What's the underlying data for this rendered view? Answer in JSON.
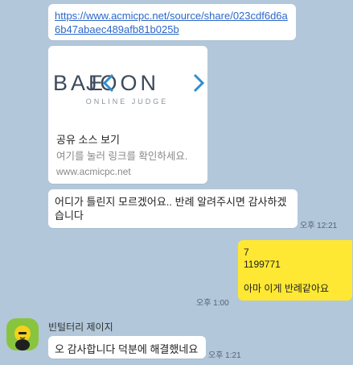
{
  "messages": {
    "link_url": "https://www.acmicpc.net/source/share/023cdf6d6a6b47abaec489afb81b025b",
    "card": {
      "logo_main_left": "BAE",
      "logo_main_right": "JOON",
      "logo_sub": "ONLINE JUDGE",
      "title": "공유 소스 보기",
      "desc": "여기를 눌러 링크를 확인하세요.",
      "domain": "www.acmicpc.net"
    },
    "question": "어디가 틀린지 모르겠어요.. 반례 알려주시면 감사하겠습니다",
    "question_time": "오후 12:21",
    "my_reply": "7\n1199771\n\n아마 이게 반례같아요",
    "my_reply_time": "오후 1:00",
    "sender_name": "빈털터리 제이지",
    "thanks": "오 감사합니다 덕분에 해결했네요",
    "thanks_time": "오후 1:21"
  },
  "colors": {
    "background": "#b2c7da",
    "my_bubble": "#fee833",
    "link": "#2c67c9",
    "logo": "#3d4a5c",
    "logo_accent": "#2e8fd0",
    "avatar_bg": "#89c43e"
  }
}
